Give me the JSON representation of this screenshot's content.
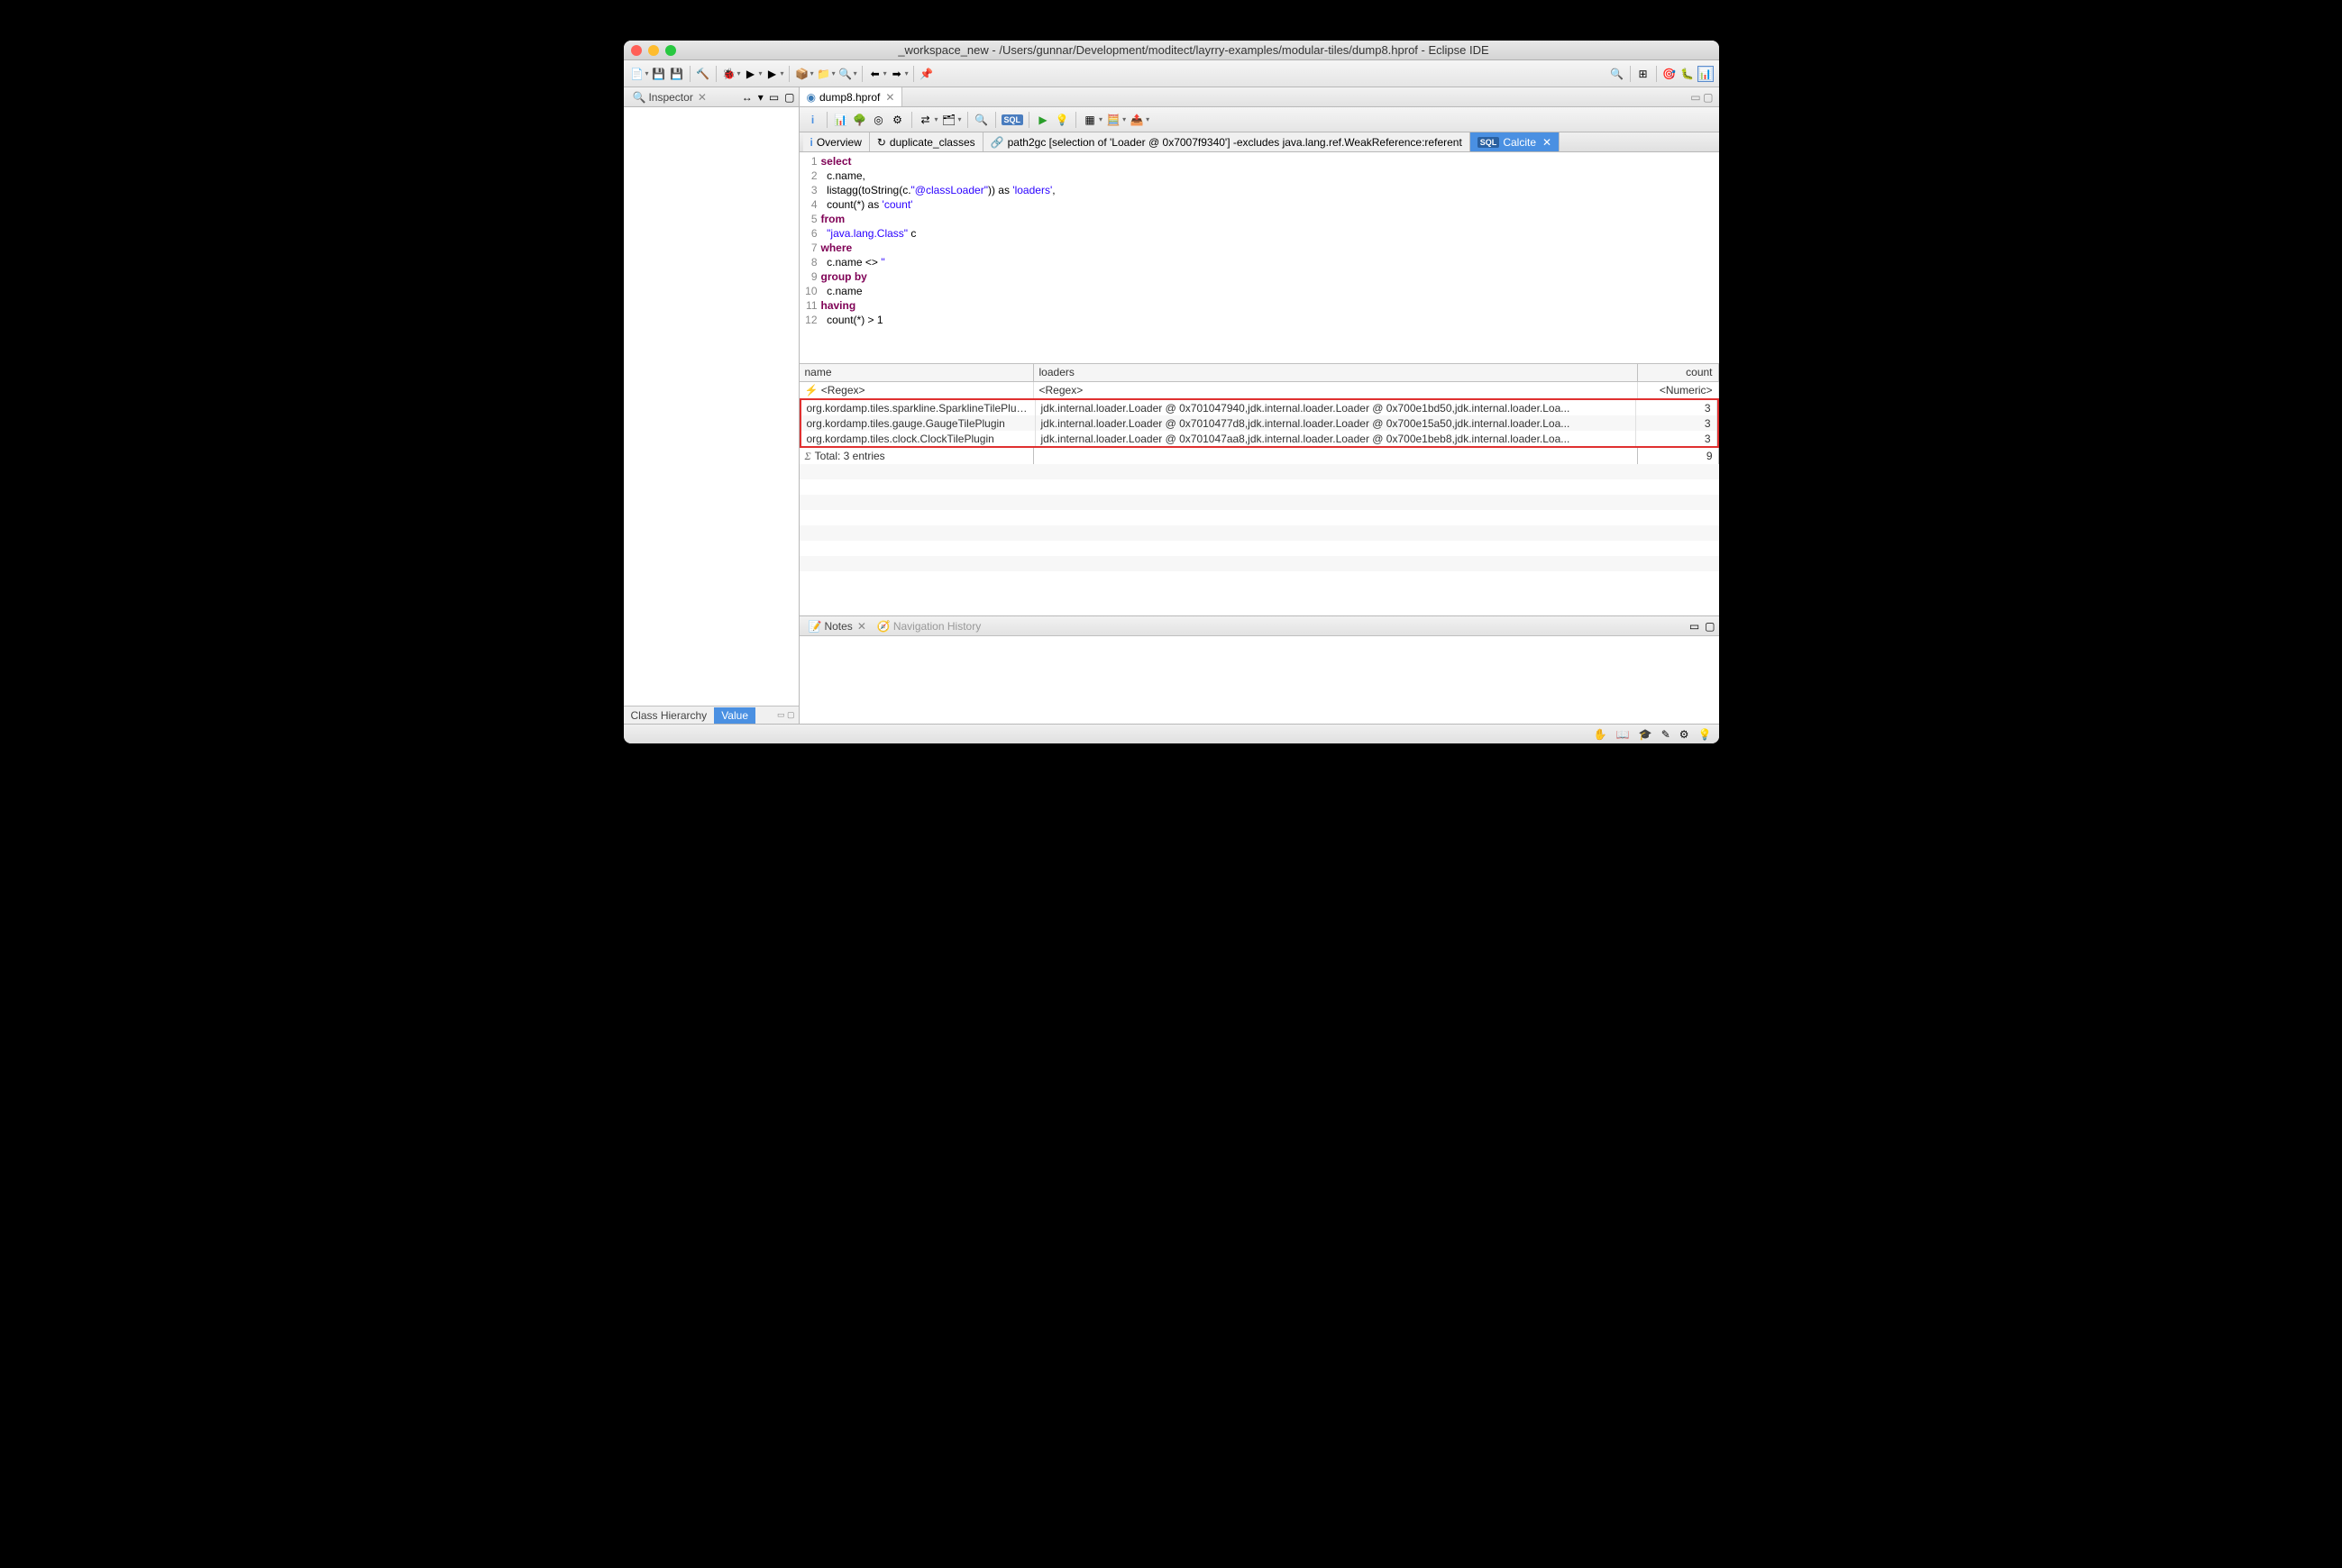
{
  "title": "_workspace_new - /Users/gunnar/Development/moditect/layrry-examples/modular-tiles/dump8.hprof - Eclipse IDE",
  "inspector": {
    "label": "Inspector"
  },
  "inspector_subtabs": {
    "hierarchy": "Class Hierarchy",
    "value": "Value"
  },
  "editor_tab": "dump8.hprof",
  "subtabs": {
    "overview": "Overview",
    "dup": "duplicate_classes",
    "path": "path2gc  [selection of 'Loader @ 0x7007f9340'] -excludes java.lang.ref.WeakReference:referent",
    "calcite": "Calcite"
  },
  "code": {
    "l1": "select",
    "l2": "  c.name,",
    "l3_a": "  listagg(toString(c.",
    "l3_b": "\"@classLoader\"",
    "l3_c": ")) as ",
    "l3_d": "'loaders'",
    "l3_e": ",",
    "l4_a": "  count(*) as ",
    "l4_b": "'count'",
    "l5": "from",
    "l6_a": "  ",
    "l6_b": "\"java.lang.Class\"",
    "l6_c": " c",
    "l7": "where",
    "l8_a": "  c.name <> ",
    "l8_b": "''",
    "l9": "group by",
    "l10": "  c.name",
    "l11": "having",
    "l12": "  count(*) > 1"
  },
  "cols": {
    "name": "name",
    "loaders": "loaders",
    "count": "count"
  },
  "filters": {
    "regex": "<Regex>",
    "numeric": "<Numeric>"
  },
  "rows": [
    {
      "name": "org.kordamp.tiles.sparkline.SparklineTilePlugin",
      "loaders": "jdk.internal.loader.Loader @ 0x701047940,jdk.internal.loader.Loader @ 0x700e1bd50,jdk.internal.loader.Loa...",
      "count": "3"
    },
    {
      "name": "org.kordamp.tiles.gauge.GaugeTilePlugin",
      "loaders": "jdk.internal.loader.Loader @ 0x7010477d8,jdk.internal.loader.Loader @ 0x700e15a50,jdk.internal.loader.Loa...",
      "count": "3"
    },
    {
      "name": "org.kordamp.tiles.clock.ClockTilePlugin",
      "loaders": "jdk.internal.loader.Loader @ 0x701047aa8,jdk.internal.loader.Loader @ 0x700e1beb8,jdk.internal.loader.Loa...",
      "count": "3"
    }
  ],
  "total": {
    "label": "Total: 3 entries",
    "sum": "9"
  },
  "bottom": {
    "notes": "Notes",
    "nav": "Navigation History"
  }
}
